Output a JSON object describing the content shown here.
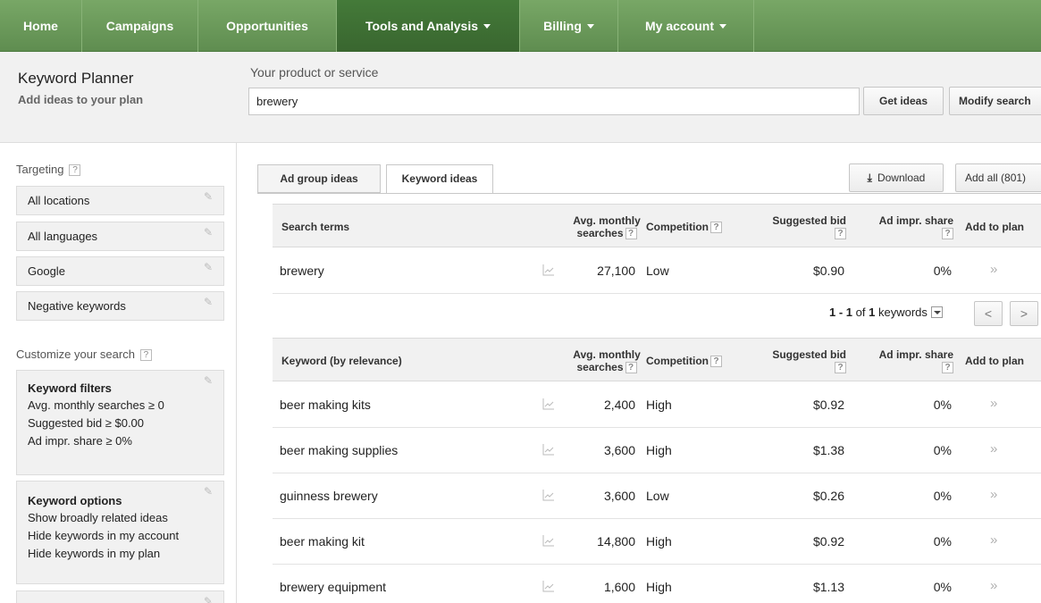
{
  "nav": {
    "items": [
      {
        "label": "Home",
        "has_menu": false
      },
      {
        "label": "Campaigns",
        "has_menu": false
      },
      {
        "label": "Opportunities",
        "has_menu": false
      },
      {
        "label": "Tools and Analysis",
        "has_menu": true,
        "active": true
      },
      {
        "label": "Billing",
        "has_menu": true
      },
      {
        "label": "My account",
        "has_menu": true
      }
    ]
  },
  "header": {
    "title": "Keyword Planner",
    "subtitle": "Add ideas to your plan",
    "product_label": "Your product or service",
    "product_value": "brewery",
    "get_ideas_label": "Get ideas",
    "modify_search_label": "Modify search"
  },
  "sidebar": {
    "targeting_heading": "Targeting",
    "targeting_items": [
      "All locations",
      "All languages",
      "Google",
      "Negative keywords"
    ],
    "customize_heading": "Customize your search",
    "keyword_filters": {
      "title": "Keyword filters",
      "lines": [
        "Avg. monthly searches ≥ 0",
        "Suggested bid ≥ $0.00",
        "Ad impr. share ≥ 0%"
      ]
    },
    "keyword_options": {
      "title": "Keyword options",
      "lines": [
        "Show broadly related ideas",
        "Hide keywords in my account",
        "Hide keywords in my plan"
      ]
    },
    "help_mark": "?"
  },
  "tabs": {
    "ad_group_ideas": "Ad group ideas",
    "keyword_ideas": "Keyword ideas",
    "active": "keyword_ideas"
  },
  "actions": {
    "download_label": "Download",
    "add_all_label": "Add all (801)"
  },
  "columns": {
    "search_terms": "Search terms",
    "keyword_by_relevance": "Keyword (by relevance)",
    "avg_monthly_1": "Avg. monthly",
    "avg_monthly_2": "searches",
    "competition": "Competition",
    "suggested_bid": "Suggested bid",
    "ad_impr_share": "Ad impr. share",
    "add_to_plan": "Add to plan"
  },
  "search_terms_rows": [
    {
      "term": "brewery",
      "searches": "27,100",
      "competition": "Low",
      "bid": "$0.90",
      "share": "0%"
    }
  ],
  "pager": {
    "range": "1 - 1",
    "of": "of",
    "total": "1",
    "unit": "keywords"
  },
  "keyword_rows": [
    {
      "term": "beer making kits",
      "searches": "2,400",
      "competition": "High",
      "bid": "$0.92",
      "share": "0%"
    },
    {
      "term": "beer making supplies",
      "searches": "3,600",
      "competition": "High",
      "bid": "$1.38",
      "share": "0%"
    },
    {
      "term": "guinness brewery",
      "searches": "3,600",
      "competition": "Low",
      "bid": "$0.26",
      "share": "0%"
    },
    {
      "term": "beer making kit",
      "searches": "14,800",
      "competition": "High",
      "bid": "$0.92",
      "share": "0%"
    },
    {
      "term": "brewery equipment",
      "searches": "1,600",
      "competition": "High",
      "bid": "$1.13",
      "share": "0%"
    }
  ],
  "icons": {
    "trend": "chart-trend-icon",
    "add": "double-chevron-right-icon",
    "edit": "pencil-icon",
    "download": "download-arrow-icon"
  },
  "colors": {
    "nav_green": "#6b9a5a",
    "nav_active": "#3e6d35",
    "header_bg": "#f1f1f1"
  }
}
